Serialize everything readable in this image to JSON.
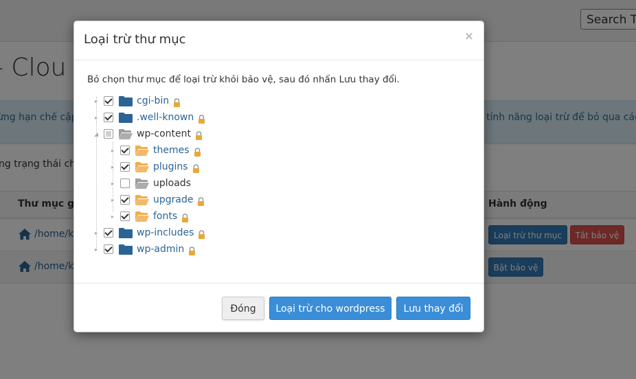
{
  "background": {
    "search_placeholder": "Search To",
    "page_title": "- Clou",
    "alert_left": "ừng hạn chế cập",
    "alert_right": "tính năng loại trừ để bỏ qua các t",
    "status_line": "ng trạng thái chỉ",
    "table": {
      "col_folder": "Thư mục gố",
      "col_action": "Hành động",
      "rows": [
        {
          "path": "/home/k",
          "buttons": [
            "Loại trừ thư mục",
            "Tắt bảo vệ"
          ]
        },
        {
          "path": "/home/k",
          "buttons": [
            "Bật bảo vệ"
          ]
        }
      ]
    }
  },
  "modal": {
    "title": "Loại trừ thư mục",
    "close": "×",
    "instructions": "Bỏ chọn thư mục để loại trừ khỏi bảo vệ, sau đó nhấn Lưu thay đổi.",
    "tree": [
      {
        "label": "cgi-bin",
        "state": "checked",
        "folder": "closed",
        "locked": true,
        "level": 0,
        "link": true
      },
      {
        "label": ".well-known",
        "state": "checked",
        "folder": "closed",
        "locked": true,
        "level": 0,
        "link": true
      },
      {
        "label": "wp-content",
        "state": "partial",
        "folder": "open-gray",
        "locked": true,
        "level": 0,
        "link": false
      },
      {
        "label": "themes",
        "state": "checked",
        "folder": "open-yellow",
        "locked": true,
        "level": 1,
        "link": true
      },
      {
        "label": "plugins",
        "state": "checked",
        "folder": "open-yellow",
        "locked": true,
        "level": 1,
        "link": true
      },
      {
        "label": "uploads",
        "state": "unchecked",
        "folder": "open-gray",
        "locked": false,
        "level": 1,
        "link": false
      },
      {
        "label": "upgrade",
        "state": "checked",
        "folder": "open-yellow",
        "locked": true,
        "level": 1,
        "link": true
      },
      {
        "label": "fonts",
        "state": "checked",
        "folder": "open-yellow",
        "locked": true,
        "level": 1,
        "link": true
      },
      {
        "label": "wp-includes",
        "state": "checked",
        "folder": "closed",
        "locked": true,
        "level": 0,
        "link": true
      },
      {
        "label": "wp-admin",
        "state": "checked",
        "folder": "closed",
        "locked": true,
        "level": 0,
        "link": true
      }
    ],
    "buttons": {
      "close": "Đóng",
      "exclude_wordpress": "Loại trừ cho wordpress",
      "save": "Lưu thay đổi"
    }
  },
  "colors": {
    "primary": "#3a8ed8",
    "danger": "#d9534f",
    "link": "#2a6496",
    "folder_blue": "#2a6496",
    "folder_yellow": "#f0ad4e",
    "folder_gray": "#9d9d9d",
    "lock": "#e8a838"
  }
}
